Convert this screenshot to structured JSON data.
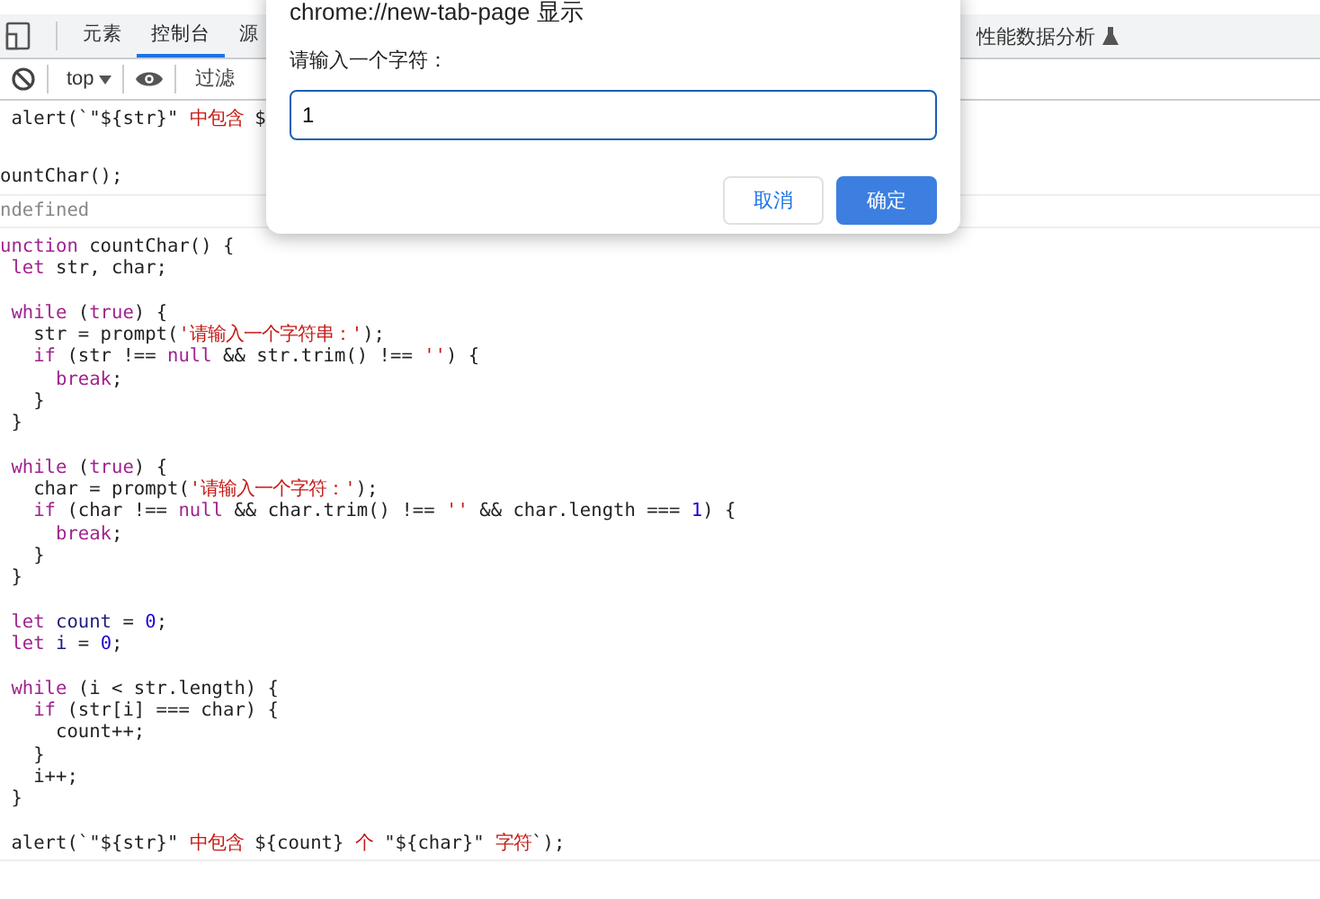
{
  "tabs": [
    {
      "label": "元素",
      "selected": false
    },
    {
      "label": "控制台",
      "selected": true
    },
    {
      "label": "源",
      "selected": false
    }
  ],
  "right_tab": {
    "label": "性能数据分析"
  },
  "toolbar": {
    "context": "top",
    "filter_placeholder": "过滤"
  },
  "console": [
    {
      "kind": "code",
      "blocks": [
        [
          [
            {
              "kind": "plain",
              "text": " alert(`\"${str}\" "
            },
            {
              "kind": "string",
              "text": "中包含"
            },
            {
              "kind": "plain",
              "text": " $"
            }
          ]
        ]
      ]
    },
    {
      "kind": "code",
      "blocks": [
        [
          [
            {
              "kind": "plain",
              "text": "ountChar();"
            }
          ]
        ]
      ]
    },
    {
      "kind": "result",
      "text": "ndefined"
    },
    {
      "kind": "code",
      "blocks": [
        [
          [
            {
              "kind": "keyword",
              "text": "unction"
            },
            {
              "kind": "plain",
              "text": " countChar() {"
            }
          ],
          [
            {
              "kind": "keyword",
              "text": " let"
            },
            {
              "kind": "plain",
              "text": " str, char;"
            }
          ]
        ],
        [
          [
            {
              "kind": "keyword",
              "text": " while"
            },
            {
              "kind": "plain",
              "text": " ("
            },
            {
              "kind": "keyword",
              "text": "true"
            },
            {
              "kind": "plain",
              "text": ") {"
            }
          ],
          [
            {
              "kind": "plain",
              "text": "   str = prompt("
            },
            {
              "kind": "string",
              "text": "'请输入一个字符串：'"
            },
            {
              "kind": "plain",
              "text": ");"
            }
          ],
          [
            {
              "kind": "keyword",
              "text": "   if"
            },
            {
              "kind": "plain",
              "text": " (str !== "
            },
            {
              "kind": "keyword",
              "text": "null"
            },
            {
              "kind": "plain",
              "text": " && str.trim() !== "
            },
            {
              "kind": "string",
              "text": "''"
            },
            {
              "kind": "plain",
              "text": ") {"
            }
          ],
          [
            {
              "kind": "keyword",
              "text": "     break"
            },
            {
              "kind": "plain",
              "text": ";"
            }
          ],
          [
            {
              "kind": "plain",
              "text": "   }"
            }
          ],
          [
            {
              "kind": "plain",
              "text": " }"
            }
          ]
        ],
        [
          [
            {
              "kind": "keyword",
              "text": " while"
            },
            {
              "kind": "plain",
              "text": " ("
            },
            {
              "kind": "keyword",
              "text": "true"
            },
            {
              "kind": "plain",
              "text": ") {"
            }
          ],
          [
            {
              "kind": "plain",
              "text": "   char = prompt("
            },
            {
              "kind": "string",
              "text": "'请输入一个字符：'"
            },
            {
              "kind": "plain",
              "text": ");"
            }
          ],
          [
            {
              "kind": "keyword",
              "text": "   if"
            },
            {
              "kind": "plain",
              "text": " (char !== "
            },
            {
              "kind": "keyword",
              "text": "null"
            },
            {
              "kind": "plain",
              "text": " && char.trim() !== "
            },
            {
              "kind": "string",
              "text": "''"
            },
            {
              "kind": "plain",
              "text": " && char.length === "
            },
            {
              "kind": "number",
              "text": "1"
            },
            {
              "kind": "plain",
              "text": ") {"
            }
          ],
          [
            {
              "kind": "keyword",
              "text": "     break"
            },
            {
              "kind": "plain",
              "text": ";"
            }
          ],
          [
            {
              "kind": "plain",
              "text": "   }"
            }
          ],
          [
            {
              "kind": "plain",
              "text": " }"
            }
          ]
        ],
        [
          [
            {
              "kind": "keyword",
              "text": " let"
            },
            {
              "kind": "variable",
              "text": " count"
            },
            {
              "kind": "plain",
              "text": " = "
            },
            {
              "kind": "number",
              "text": "0"
            },
            {
              "kind": "plain",
              "text": ";"
            }
          ],
          [
            {
              "kind": "keyword",
              "text": " let"
            },
            {
              "kind": "variable",
              "text": " i"
            },
            {
              "kind": "plain",
              "text": " = "
            },
            {
              "kind": "number",
              "text": "0"
            },
            {
              "kind": "plain",
              "text": ";"
            }
          ]
        ],
        [
          [
            {
              "kind": "keyword",
              "text": " while"
            },
            {
              "kind": "plain",
              "text": " (i < str.length) {"
            }
          ],
          [
            {
              "kind": "keyword",
              "text": "   if"
            },
            {
              "kind": "plain",
              "text": " (str[i] === char) {"
            }
          ],
          [
            {
              "kind": "plain",
              "text": "     count++;"
            }
          ],
          [
            {
              "kind": "plain",
              "text": "   }"
            }
          ],
          [
            {
              "kind": "plain",
              "text": "   i++;"
            }
          ],
          [
            {
              "kind": "plain",
              "text": " }"
            }
          ]
        ],
        [
          [
            {
              "kind": "plain",
              "text": " alert(`\"${str}\" "
            },
            {
              "kind": "string",
              "text": "中包含"
            },
            {
              "kind": "plain",
              "text": " ${count} "
            },
            {
              "kind": "string",
              "text": "个"
            },
            {
              "kind": "plain",
              "text": " \"${char}\" "
            },
            {
              "kind": "string",
              "text": "字符"
            },
            {
              "kind": "plain",
              "text": "`);"
            }
          ]
        ]
      ]
    }
  ],
  "dialog": {
    "title": "chrome://new-tab-page 显示",
    "label": "请输入一个字符：",
    "value": "1",
    "buttons": [
      {
        "label": "取消",
        "kind": "secondary"
      },
      {
        "label": "确定",
        "kind": "primary"
      }
    ]
  }
}
